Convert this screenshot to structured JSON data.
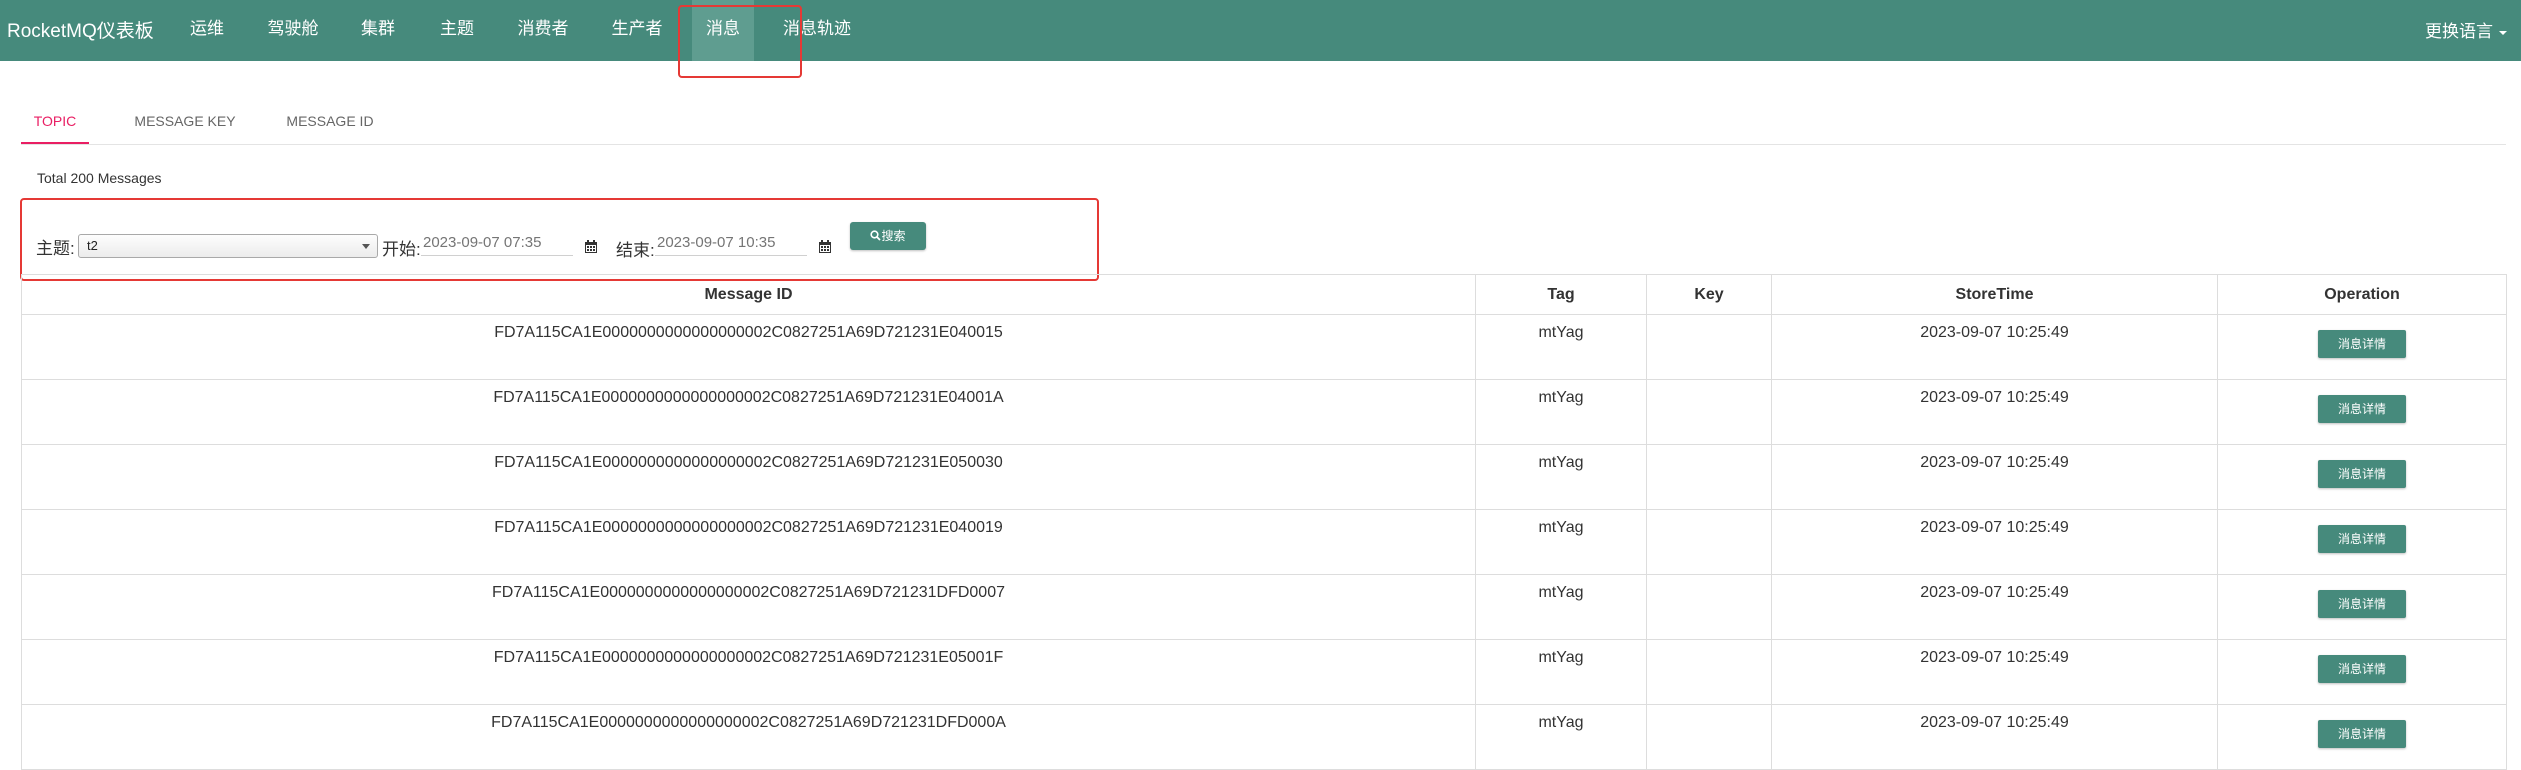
{
  "navbar": {
    "brand": "RocketMQ仪表板",
    "items": [
      "运维",
      "驾驶舱",
      "集群",
      "主题",
      "消费者",
      "生产者",
      "消息",
      "消息轨迹"
    ],
    "active_item": "消息",
    "language_label": "更换语言"
  },
  "tabs": [
    {
      "label": "TOPIC",
      "active": true
    },
    {
      "label": "MESSAGE KEY",
      "active": false
    },
    {
      "label": "MESSAGE ID",
      "active": false
    }
  ],
  "summary": {
    "total": "Total 200 Messages"
  },
  "filters": {
    "topic_label": "主题:",
    "topic_value": "t2",
    "start_label": "开始:",
    "start_placeholder": "2023-09-07 07:35",
    "end_label": "结束:",
    "end_placeholder": "2023-09-07 10:35",
    "search_label": "搜索",
    "calendar_icon": "calendar-icon",
    "search_icon": "search-icon"
  },
  "table": {
    "columns": [
      "Message ID",
      "Tag",
      "Key",
      "StoreTime",
      "Operation"
    ],
    "rows": [
      {
        "id": "FD7A115CA1E0000000000000000002C0827251A69D721231E040015",
        "tag": "mtYag",
        "key": "",
        "time": "2023-09-07 10:25:49",
        "action": "消息详情"
      },
      {
        "id": "FD7A115CA1E0000000000000000002C0827251A69D721231E04001A",
        "tag": "mtYag",
        "key": "",
        "time": "2023-09-07 10:25:49",
        "action": "消息详情"
      },
      {
        "id": "FD7A115CA1E0000000000000000002C0827251A69D721231E050030",
        "tag": "mtYag",
        "key": "",
        "time": "2023-09-07 10:25:49",
        "action": "消息详情"
      },
      {
        "id": "FD7A115CA1E0000000000000000002C0827251A69D721231E040019",
        "tag": "mtYag",
        "key": "",
        "time": "2023-09-07 10:25:49",
        "action": "消息详情"
      },
      {
        "id": "FD7A115CA1E0000000000000000002C0827251A69D721231DFD0007",
        "tag": "mtYag",
        "key": "",
        "time": "2023-09-07 10:25:49",
        "action": "消息详情"
      },
      {
        "id": "FD7A115CA1E0000000000000000002C0827251A69D721231E05001F",
        "tag": "mtYag",
        "key": "",
        "time": "2023-09-07 10:25:49",
        "action": "消息详情"
      },
      {
        "id": "FD7A115CA1E0000000000000000002C0827251A69D721231DFD000A",
        "tag": "mtYag",
        "key": "",
        "time": "2023-09-07 10:25:49",
        "action": "消息详情"
      }
    ]
  },
  "colors": {
    "navbar": "#468a7c",
    "active_nav": "#5f9d90",
    "accent_tab": "#e91e63",
    "annotation": "#e53935"
  }
}
